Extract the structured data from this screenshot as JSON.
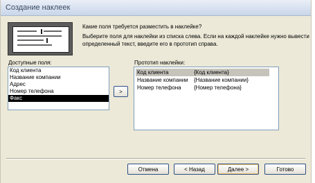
{
  "window": {
    "title": "Создание наклеек"
  },
  "intro": {
    "question": "Какие поля требуется разместить в наклейке?",
    "instructions": "Выберите поля для наклейки из списка слева. Если на каждой наклейке нужно вывести определенный текст, введите его в прототип справа."
  },
  "available": {
    "label": "Доступные поля:",
    "items": [
      "Код клиента",
      "Название компании",
      "Адрес",
      "Номер телефона",
      "Факс"
    ],
    "selected_index": 4
  },
  "prototype": {
    "label": "Прототип наклейки:",
    "rows": [
      {
        "text": "Код клиента",
        "field": "{Код клиента}"
      },
      {
        "text": "Название компании",
        "field": "{Название компании}"
      },
      {
        "text": "Номер телефона",
        "field": "{Номер телефона}"
      }
    ]
  },
  "buttons": {
    "add": ">",
    "cancel": "Отмена",
    "back": "< Назад",
    "next": "Далее >",
    "finish": "Готово"
  }
}
